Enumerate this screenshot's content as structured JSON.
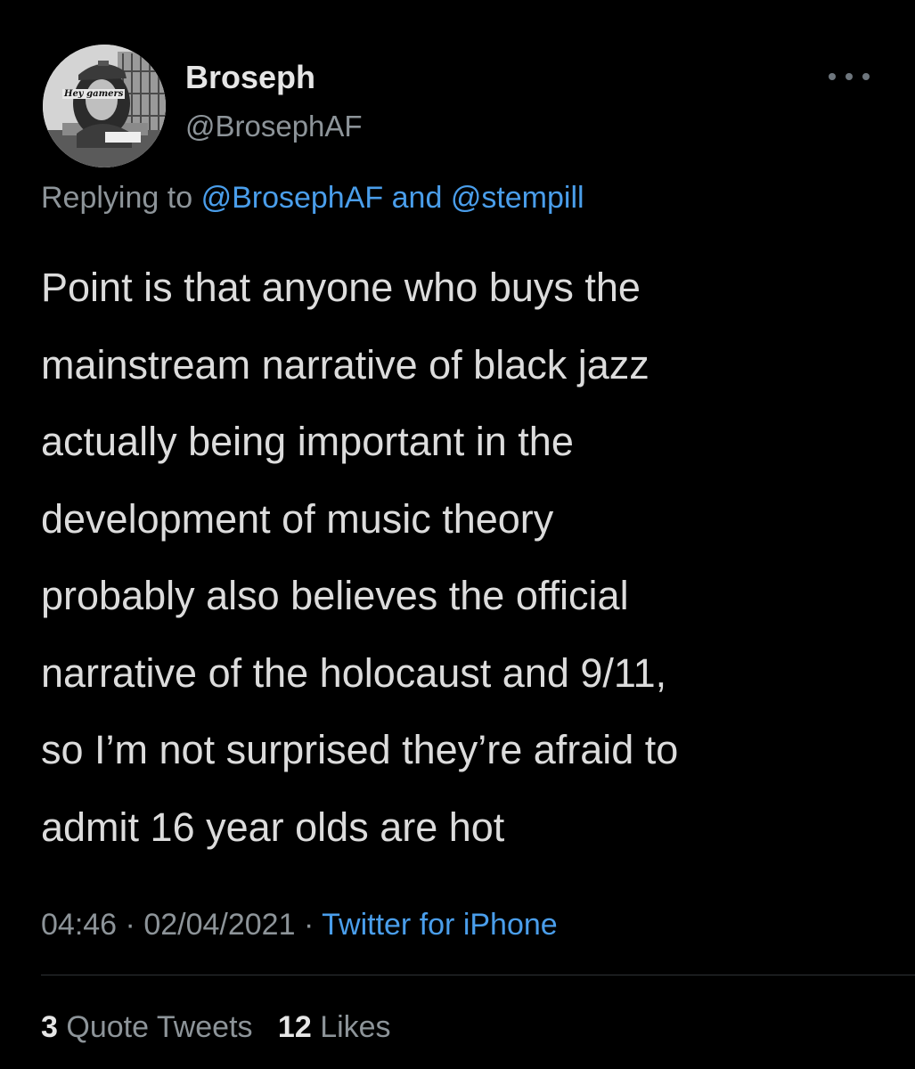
{
  "author": {
    "display_name": "Broseph",
    "handle": "@BrosephAF",
    "avatar_caption": "Hey gamers"
  },
  "reply_context": {
    "prefix": "Replying to",
    "user1": "@BrosephAF",
    "conjunction": "and",
    "user2": "@stempill"
  },
  "tweet": {
    "lines": [
      "Point is that anyone who buys the",
      "mainstream narrative of black jazz",
      "actually being important in the",
      "development of music theory",
      "probably also believes the official",
      "narrative of the holocaust and 9/11,",
      "so I’m not surprised they’re afraid to",
      "admit 16 year olds are hot"
    ]
  },
  "meta": {
    "time": "04:46",
    "separator": "·",
    "date": "02/04/2021",
    "source": "Twitter for iPhone"
  },
  "stats": {
    "quote_count": "3",
    "quote_label": "Quote Tweets",
    "likes_count": "12",
    "likes_label": "Likes"
  },
  "icons": {
    "more": "more-horizontal-icon"
  },
  "colors": {
    "background": "#000000",
    "link": "#4a9eeb",
    "secondary_text": "#8d9499",
    "primary_text": "#dcdcdc"
  }
}
